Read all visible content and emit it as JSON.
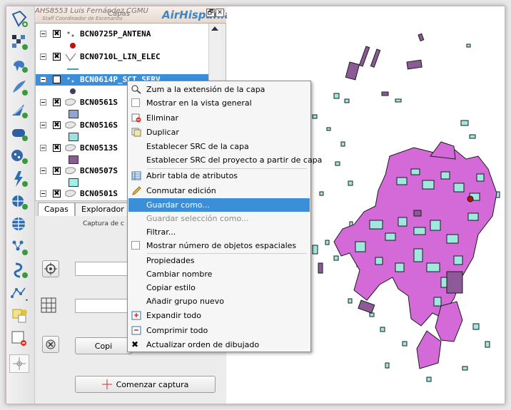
{
  "banner": {
    "user": "AHS8553 Luis Fernández CGMU",
    "role": "Staff Coordinador de Escenarios",
    "panel_title": "Capas",
    "brand": "AirHispania",
    "restore_btn": "🗗",
    "close_btn": "✕"
  },
  "layers": [
    {
      "name": "BCN0725P_ANTENA",
      "checked": "✖",
      "symbol": "point",
      "color": "#b11111"
    },
    {
      "name": "BCN0710L_LIN_ELEC",
      "checked": "✖",
      "symbol": "line",
      "color": "#3aa6a6"
    },
    {
      "name": "BCN0614P_SCT_SERV",
      "checked": "✖",
      "symbol": "point",
      "color": "#4a4a6a"
    },
    {
      "name": "BCN0561S",
      "checked": "✖",
      "symbol": "polygon",
      "color": "#8fa6d4"
    },
    {
      "name": "BCN0516S",
      "checked": "✖",
      "symbol": "polygon",
      "color": "#9fe0e0"
    },
    {
      "name": "BCN0513S",
      "checked": "✖",
      "symbol": "polygon",
      "color": "#8c5a96"
    },
    {
      "name": "BCN0507S",
      "checked": "✖",
      "symbol": "polygon",
      "color": "#9ff0ea"
    },
    {
      "name": "BCN0501S",
      "checked": "✖",
      "symbol": "polygon",
      "color": "#d45ad4"
    }
  ],
  "tabs": [
    {
      "label": "Capas"
    },
    {
      "label": "Explorador"
    }
  ],
  "dock": {
    "title": "Captura de c",
    "copy_button": "Copi",
    "start_capture_button": "Comenzar captura"
  },
  "menu": {
    "items": [
      {
        "label": "Zum a la extensión de la capa",
        "icon": "zoom-icon"
      },
      {
        "label": "Mostrar en la vista general",
        "icon": "checkbox-icon"
      },
      {
        "label": "Eliminar",
        "icon": "remove-layer-icon"
      },
      {
        "label": "Duplicar",
        "icon": "duplicate-icon"
      },
      {
        "label": "Establecer SRC de la capa",
        "icon": ""
      },
      {
        "label": "Establecer SRC del proyecto a partir de capa",
        "icon": ""
      },
      {
        "label": "Abrir tabla de atributos",
        "icon": "table-icon"
      },
      {
        "label": "Conmutar edición",
        "icon": "pencil-icon"
      },
      {
        "label": "Guardar como...",
        "icon": "",
        "highlighted": true
      },
      {
        "label": "Guardar selección como...",
        "icon": "",
        "disabled": true
      },
      {
        "label": "Filtrar...",
        "icon": ""
      },
      {
        "label": "Mostrar número de objetos espaciales",
        "icon": "checkbox-icon"
      },
      {
        "label": "Propiedades",
        "icon": ""
      },
      {
        "label": "Cambiar nombre",
        "icon": ""
      },
      {
        "label": "Copiar estilo",
        "icon": ""
      },
      {
        "label": "Añadir grupo nuevo",
        "icon": ""
      },
      {
        "label": "Expandir todo",
        "icon": "expand-icon"
      },
      {
        "label": "Comprimir todo",
        "icon": "collapse-icon"
      },
      {
        "label": "Actualizar orden de dibujado",
        "icon": "checked-x-icon"
      }
    ]
  },
  "colors": {
    "highlight": "#3b8fd8",
    "map_fill_magenta": "#d36ad8",
    "map_fill_cyan": "#9fe8e0",
    "map_fill_purple": "#8c5a96"
  }
}
